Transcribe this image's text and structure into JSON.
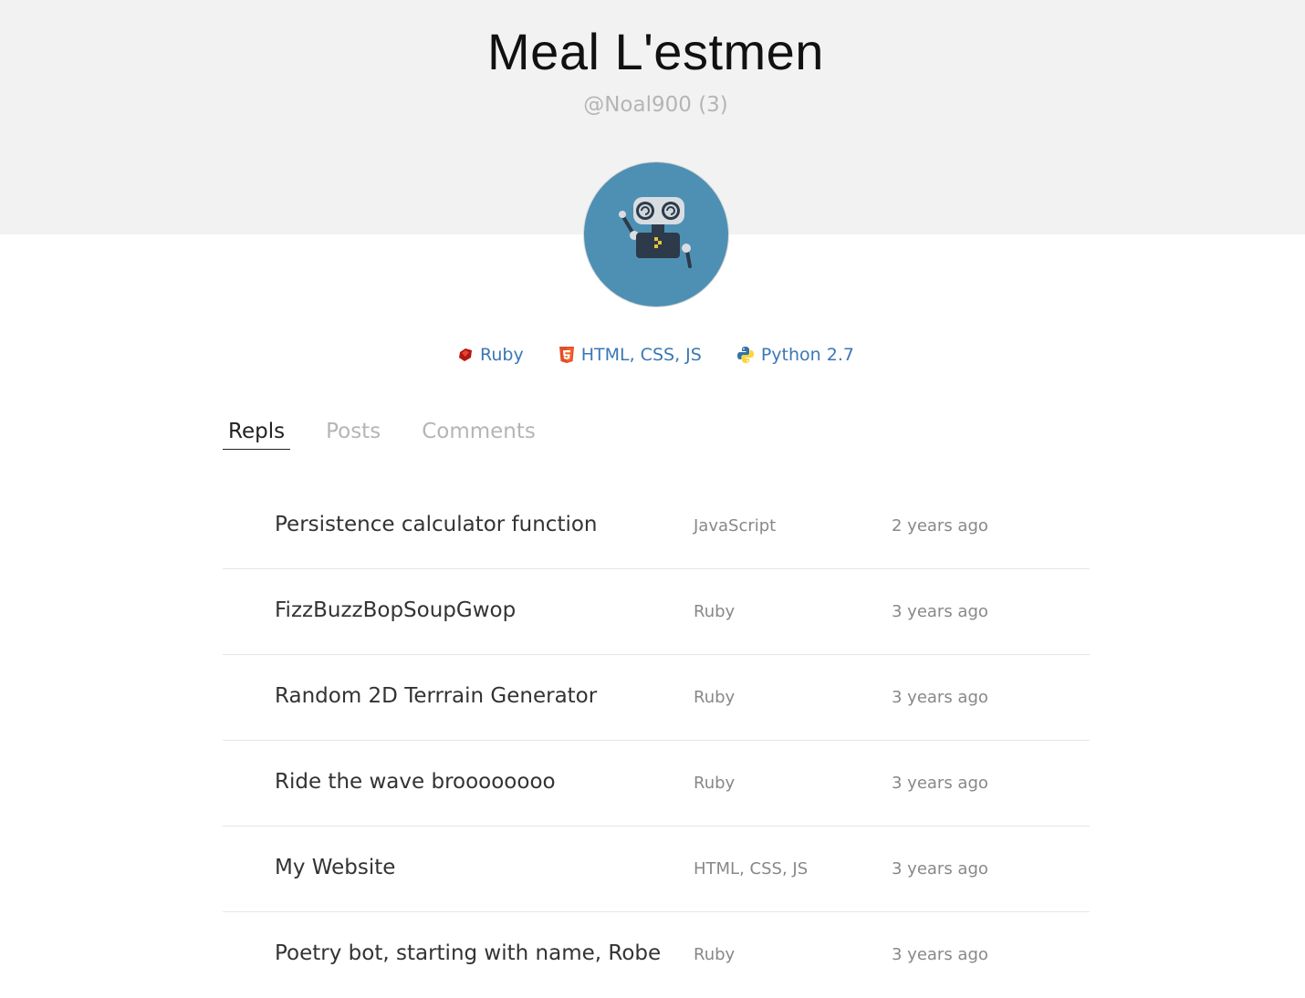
{
  "profile": {
    "name": "Meal L'estmen",
    "handle": "@Noal900 (3)"
  },
  "languages": [
    {
      "label": "Ruby",
      "icon": "ruby-icon",
      "color": "#b3160f"
    },
    {
      "label": "HTML, CSS, JS",
      "icon": "html5-icon",
      "color": "#e44d26"
    },
    {
      "label": "Python 2.7",
      "icon": "python-icon",
      "color": "#3572a5"
    }
  ],
  "tabs": [
    {
      "label": "Repls",
      "active": true
    },
    {
      "label": "Posts",
      "active": false
    },
    {
      "label": "Comments",
      "active": false
    }
  ],
  "repls": [
    {
      "title": "Persistence calculator function",
      "language": "JavaScript",
      "time": "2 years ago"
    },
    {
      "title": "FizzBuzzBopSoupGwop",
      "language": "Ruby",
      "time": "3 years ago"
    },
    {
      "title": "Random 2D Terrrain Generator",
      "language": "Ruby",
      "time": "3 years ago"
    },
    {
      "title": "Ride the wave broooooooo",
      "language": "Ruby",
      "time": "3 years ago"
    },
    {
      "title": "My Website",
      "language": "HTML, CSS, JS",
      "time": "3 years ago"
    },
    {
      "title": "Poetry bot, starting with name, Robe",
      "language": "Ruby",
      "time": "3 years ago"
    }
  ],
  "colors": {
    "header_bg": "#f2f2f2",
    "avatar_bg": "#4e90b4",
    "link": "#3a78b5",
    "muted": "#b5b5b5"
  }
}
